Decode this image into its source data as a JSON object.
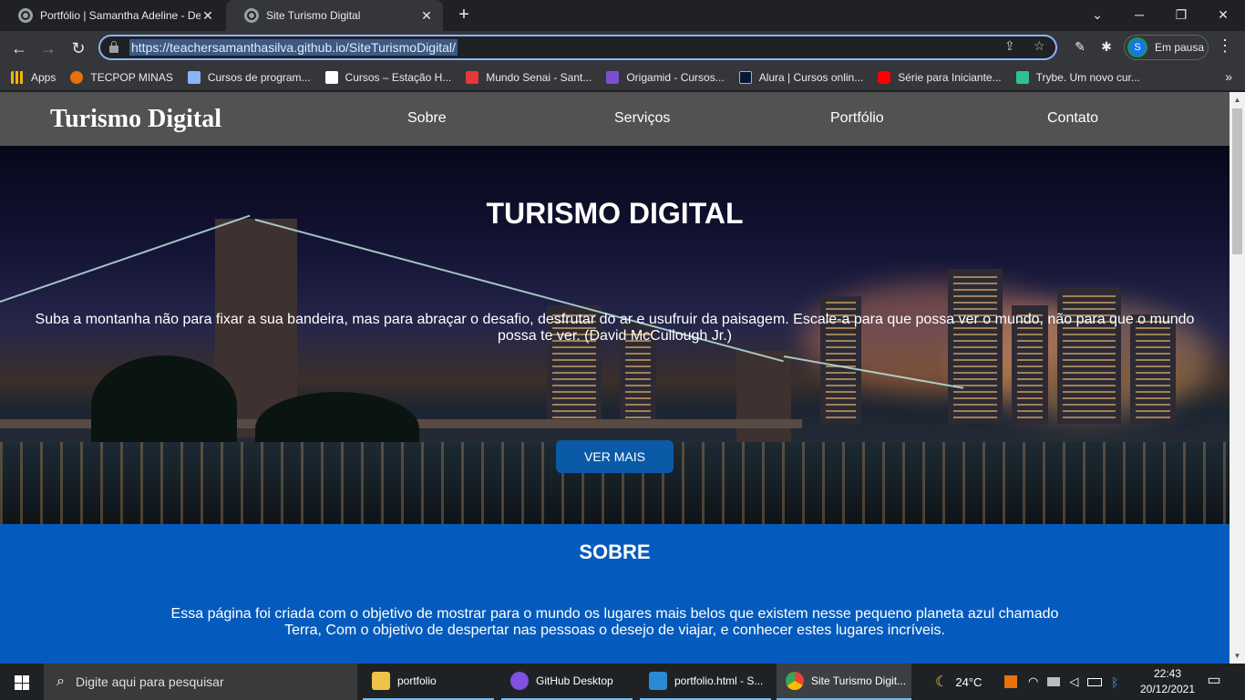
{
  "browser": {
    "tabs": [
      {
        "title": "Portfólio | Samantha Adeline - De",
        "active": false
      },
      {
        "title": "Site Turismo Digital",
        "active": true
      }
    ],
    "new_tab": "+",
    "url": "https://teachersamanthasilva.github.io/SiteTurismoDigital/",
    "profile": {
      "initial": "S",
      "label": "Em pausa"
    },
    "bookmarks": [
      {
        "label": "Apps",
        "icon": "apps-grid-icon",
        "color": "#f4b400"
      },
      {
        "label": "TECPOP MINAS",
        "icon": "tecpop-icon",
        "color": "#e8710a"
      },
      {
        "label": "Cursos de program...",
        "icon": "snowflake-icon",
        "color": "#8ab4f8"
      },
      {
        "label": "Cursos – Estação H...",
        "icon": "estacao-icon",
        "color": "#ffffff"
      },
      {
        "label": "Mundo Senai - Sant...",
        "icon": "senai-icon",
        "color": "#e53935"
      },
      {
        "label": "Origamid - Cursos...",
        "icon": "origamid-icon",
        "color": "#7b4fd1"
      },
      {
        "label": "Alura | Cursos onlin...",
        "icon": "alura-icon",
        "color": "#051933"
      },
      {
        "label": "Série para Iniciante...",
        "icon": "youtube-icon",
        "color": "#ff0000"
      },
      {
        "label": "Trybe. Um novo cur...",
        "icon": "trybe-icon",
        "color": "#2fc18c"
      }
    ]
  },
  "site": {
    "brand": "Turismo Digital",
    "nav": [
      "Sobre",
      "Serviços",
      "Portfólio",
      "Contato"
    ],
    "hero": {
      "title": "TURISMO DIGITAL",
      "quote": "Suba a montanha não para fixar a sua bandeira, mas para abraçar o desafio, desfrutar do ar e usufruir da paisagem. Escale-a para que possa ver o mundo, não para que o mundo possa te ver. (David McCullough Jr.)",
      "button": "VER MAIS"
    },
    "sobre": {
      "title": "SOBRE",
      "text": "Essa página foi criada com o objetivo de mostrar para o mundo os lugares mais belos que existem nesse pequeno planeta azul chamado Terra, Com o objetivo de despertar nas pessoas o desejo de viajar, e conhecer estes lugares incríveis."
    },
    "colors": {
      "nav_bg": "#525252",
      "accent_blue": "#055bbd",
      "button_blue": "#0a5aa8"
    }
  },
  "taskbar": {
    "search_placeholder": "Digite aqui para pesquisar",
    "items": [
      {
        "label": "portfolio",
        "icon": "folder-icon",
        "color": "#f1c24a"
      },
      {
        "label": "GitHub Desktop",
        "icon": "github-desktop-icon",
        "color": "#8250df"
      },
      {
        "label": "portfolio.html - S...",
        "icon": "vscode-icon",
        "color": "#2a8ad4"
      },
      {
        "label": "Site Turismo Digit...",
        "icon": "chrome-icon",
        "color": "#4285f4"
      }
    ],
    "weather": "24°C",
    "time": "22:43",
    "date": "20/12/2021"
  }
}
